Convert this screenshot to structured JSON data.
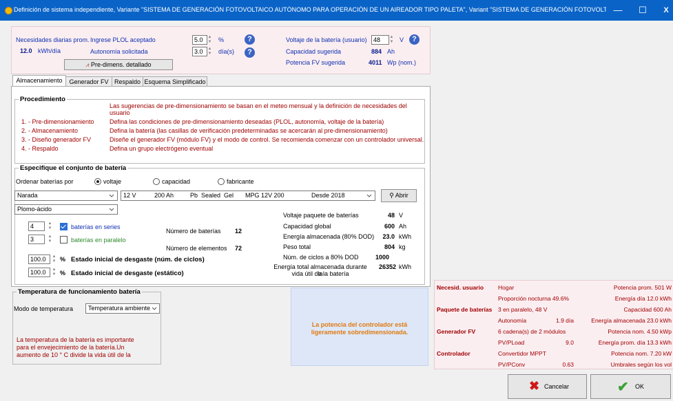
{
  "window": {
    "title": "Definición de sistema independiente, Variante  \"SISTEMA DE GENERACIÓN FOTOVOLTAICO AUTÓNOMO PARA OPERACIÓN DE UN AIREADOR TIPO PALETA\", Variant  \"SISTEMA DE GENERACIÓN FOTOVOLTA...",
    "min": "—",
    "max": "☐",
    "close": "X"
  },
  "needs": {
    "daily_label": "Necesidades diarias prom.",
    "daily_value": "12.0",
    "daily_unit": "kWh/día",
    "plol_label": "Ingrese PLOL aceptado",
    "plol_value": "5.0",
    "plol_unit": "%",
    "autonomy_label": "Autonomía solicitada",
    "autonomy_value": "3.0",
    "autonomy_unit": "día(s)",
    "predim_button": "Pre-dimens. detallado",
    "voltage_label": "Voltaje de la batería (usuario)",
    "voltage_value": "48",
    "voltage_unit": "V",
    "capacity_label": "Capacidad sugerida",
    "capacity_value": "884",
    "capacity_unit": "Ah",
    "pv_power_label": "Potencia FV sugerida",
    "pv_power_value": "4011",
    "pv_power_unit": "Wp (nom.)"
  },
  "tabs": [
    "Almacenamiento",
    "Generador FV",
    "Respaldo",
    "Esquema Simplificado"
  ],
  "procedure": {
    "title": "Procedimiento",
    "intro": "Las sugerencias de pre-dimensionamiento se basan en el meteo mensual y la definición de necesidades del usuario",
    "steps": [
      {
        "label": "1. - Pre-dimensionamiento",
        "text": "Defina las condiciones de pre-dimensionamiento deseadas (PLOL, autonomía, voltaje de la batería)"
      },
      {
        "label": "2. - Almacenamiento",
        "text": "Defina la batería (las casillas de verificación predeterminadas se acercarán al pre-dimensionamiento)"
      },
      {
        "label": "3. - Diseño generador FV",
        "text": "Diseñe el generador FV (módulo FV) y el modo de control. Se recomienda comenzar con un controlador universal."
      },
      {
        "label": "4. - Respaldo",
        "text": "Defina un grupo electrógeno eventual"
      }
    ]
  },
  "battery_set": {
    "title": "Especifique el conjunto de batería",
    "sort_label": "Ordenar baterías por",
    "sort_options": [
      "voltaje",
      "capacidad",
      "fabricante"
    ],
    "brand": "Narada",
    "model": {
      "v": "12 V",
      "ah": "200 Ah",
      "tech": "Pb  Sealed  Gel",
      "name": "MPG 12V 200",
      "since": "Desde 2018"
    },
    "open_button": "Abrir",
    "type": "Plomo-ácido",
    "series_value": "4",
    "series_label": "baterías en series",
    "parallel_value": "3",
    "parallel_label": "baterías en paralelo",
    "n_batteries_label": "Número de baterías",
    "n_batteries_value": "12",
    "n_elements_label": "Número de elementos",
    "n_elements_value": "72",
    "wear_cycles_value": "100.0",
    "wear_unit": "%",
    "wear_cycles_label": "Estado inicial de desgaste (núm. de ciclos)",
    "wear_static_value": "100.0",
    "wear_static_label": "Estado inicial de desgaste (estático)",
    "stats": [
      {
        "label": "Voltaje paquete de baterías",
        "value": "48",
        "unit": "V"
      },
      {
        "label": "Capacidad global",
        "value": "600",
        "unit": "Ah"
      },
      {
        "label": "Energía almacenada (80% DOD)",
        "value": "23.0",
        "unit": "kWh"
      },
      {
        "label": "Peso total",
        "value": "804",
        "unit": "kg"
      },
      {
        "label": "Núm. de ciclos a 80% DOD",
        "value": "1000",
        "unit": ""
      }
    ],
    "lifetime_label_1": "Energía total almacenada durante la",
    "lifetime_label_2": "vida útil de la batería",
    "lifetime_value": "26352",
    "lifetime_unit": "kWh"
  },
  "temperature": {
    "title": "Temperatura de funcionamiento batería",
    "mode_label": "Modo de temperatura",
    "mode_value": "Temperatura ambiente",
    "note_1": "La temperatura de la batería es importante",
    "note_2": "para el envejecimiento de la batería.Un",
    "note_3": "aumento de 10 ° C divide la vida útil de la"
  },
  "warning": {
    "line1": "La potencia del controlador está",
    "line2": "ligeramente sobredimensionada."
  },
  "summary": {
    "rows": [
      {
        "head": "Necesid. usuario",
        "c1": "Hogar",
        "c2": "",
        "c3": "Potencia prom.  501 W"
      },
      {
        "head": "",
        "c1": "Proporción nocturna 49.6%",
        "c2": "",
        "c3": "Energía día  12.0 kWh"
      },
      {
        "head": "Paquete de baterías",
        "c1": "3 en paralelo, 48 V",
        "c2": "",
        "c3": "Capacidad  600 Ah"
      },
      {
        "head": "",
        "c1": "Autonomía",
        "c2": "1.9 día",
        "c3": "Energía almacenada  23.0 kWh"
      },
      {
        "head": "Generador FV",
        "c1": "6 cadena(s) de 2 módulos",
        "c2": "",
        "c3": "Potencia nom.  4.50 kWp"
      },
      {
        "head": "",
        "c1": "PV/PLoad",
        "c2": "9.0",
        "c3": "Energía prom. día  13.3 kWh"
      },
      {
        "head": "Controlador",
        "c1": "Convertidor MPPT",
        "c2": "",
        "c3": "Potencia nom.  7.20 kW"
      },
      {
        "head": "",
        "c1": "PV/PConv",
        "c2": "0.63",
        "c3": "Umbrales  según los vol"
      }
    ]
  },
  "actions": {
    "cancel": "Cancelar",
    "ok": "OK"
  },
  "colors": {
    "title_bar": "#0a64c8",
    "needs_bg": "#fbeef1",
    "warning_bg": "#dde7f8",
    "warning_text": "#e07a10",
    "label_blue": "#1030b0",
    "label_red": "#a00000"
  }
}
